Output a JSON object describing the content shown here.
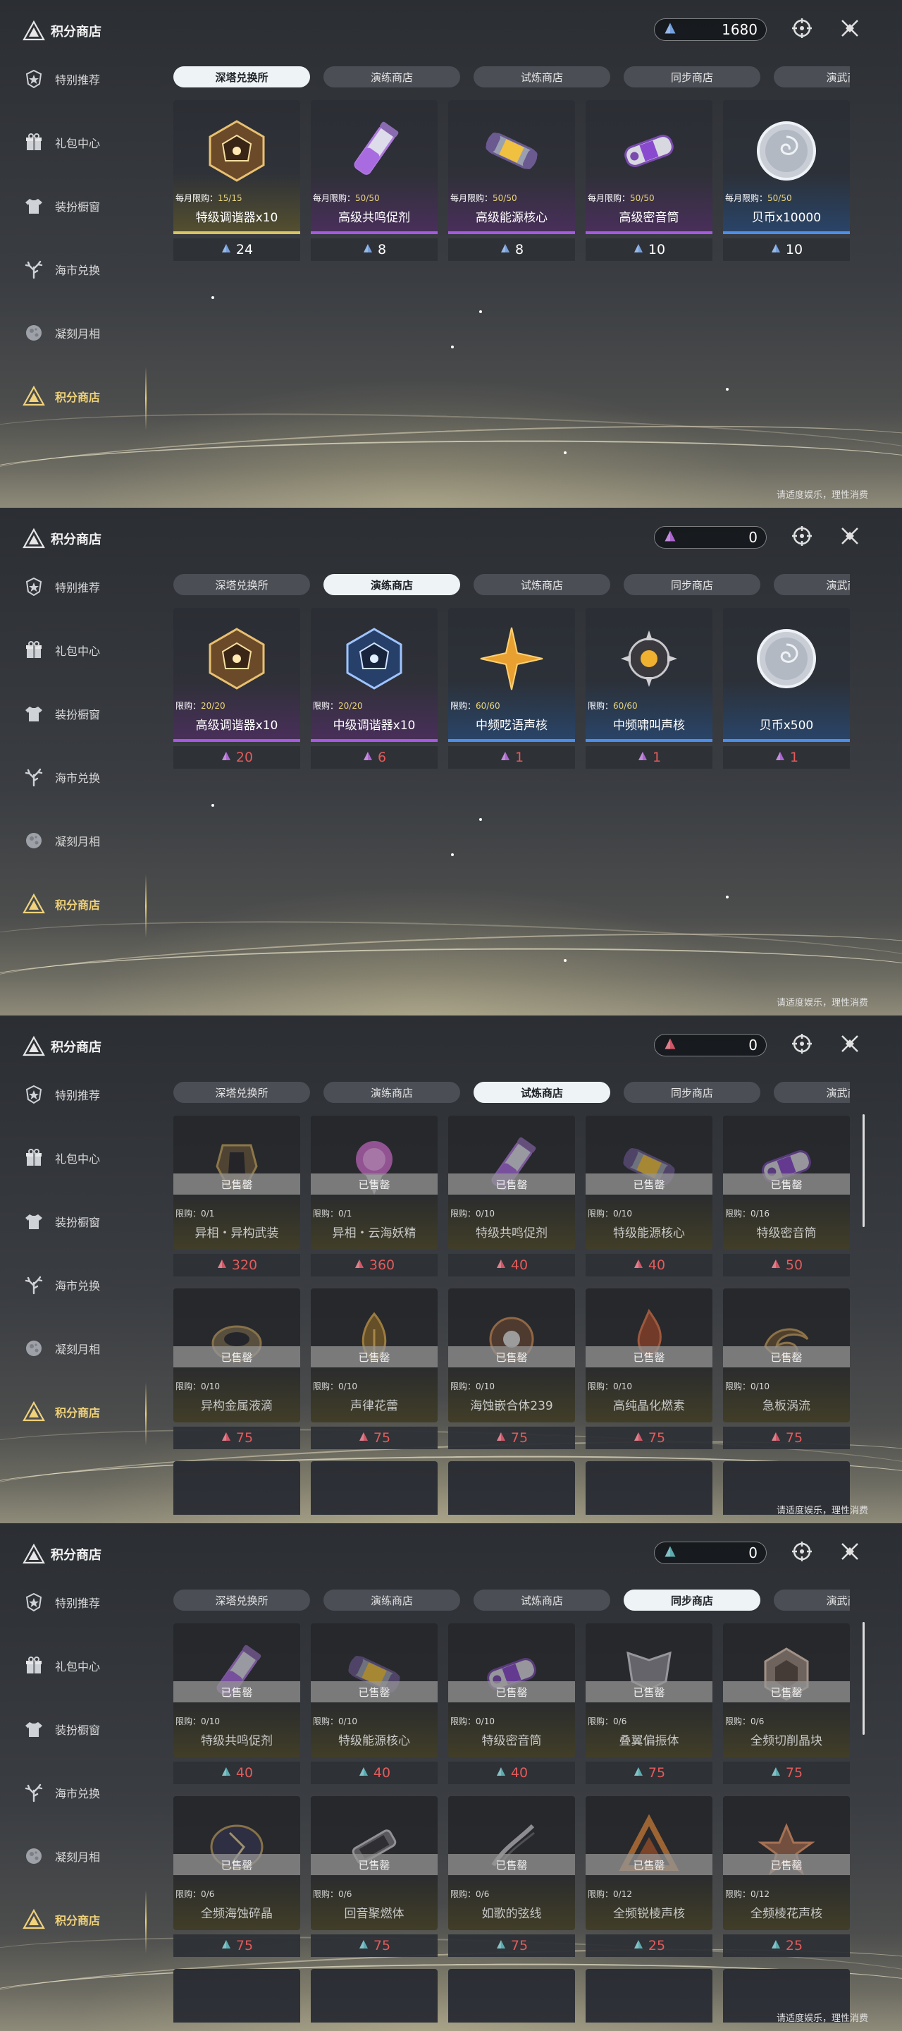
{
  "app": {
    "title": "积分商店",
    "nav": [
      {
        "label": "特别推荐",
        "icon": "star-shield-icon"
      },
      {
        "label": "礼包中心",
        "icon": "gift-icon"
      },
      {
        "label": "装扮橱窗",
        "icon": "outfit-icon"
      },
      {
        "label": "海市兑换",
        "icon": "coral-icon"
      },
      {
        "label": "凝刻月相",
        "icon": "moon-icon"
      },
      {
        "label": "积分商店",
        "icon": "triangle-emblem-icon"
      }
    ],
    "tip": "请适度娱乐，理性消费",
    "sold_label": "已售罄",
    "limit_prefix_monthly": "每月限购：",
    "limit_prefix": "限购：",
    "tabs": [
      "深塔兑换所",
      "演练商店",
      "试炼商店",
      "同步商店",
      "演武商"
    ],
    "colors": {
      "accent_gold": "#f0d27a",
      "price_red": "#e25b5b",
      "tab_active": "#eef3f6"
    }
  },
  "panels": [
    {
      "balance": "1680",
      "currency_color": "#7aa8e8",
      "active_tab": 0,
      "items": [
        {
          "name": "特级调谐器x10",
          "limit": "15/15",
          "monthly": true,
          "price": "24",
          "rarity": "gold",
          "icon": "dodecahedron-icon"
        },
        {
          "name": "高级共鸣促剂",
          "limit": "50/50",
          "monthly": true,
          "price": "8",
          "rarity": "purple",
          "icon": "vial-icon"
        },
        {
          "name": "高级能源核心",
          "limit": "50/50",
          "monthly": true,
          "price": "8",
          "rarity": "purple",
          "icon": "energy-core-icon"
        },
        {
          "name": "高级密音筒",
          "limit": "50/50",
          "monthly": true,
          "price": "10",
          "rarity": "purple",
          "icon": "sound-tube-icon"
        },
        {
          "name": "贝币x10000",
          "limit": "50/50",
          "monthly": true,
          "price": "10",
          "rarity": "blue",
          "icon": "coin-icon"
        }
      ]
    },
    {
      "balance": "0",
      "currency_color": "#b36ad8",
      "active_tab": 1,
      "items": [
        {
          "name": "高级调谐器x10",
          "limit": "20/20",
          "monthly": false,
          "price": "20",
          "rarity": "purple",
          "icon": "dodecahedron-icon"
        },
        {
          "name": "中级调谐器x10",
          "limit": "20/20",
          "monthly": false,
          "price": "6",
          "rarity": "purple",
          "icon": "dodecahedron-blue-icon"
        },
        {
          "name": "中频呓语声核",
          "limit": "60/60",
          "monthly": false,
          "price": "1",
          "rarity": "blue",
          "icon": "star-core-icon"
        },
        {
          "name": "中频啸叫声核",
          "limit": "60/60",
          "monthly": false,
          "price": "1",
          "rarity": "blue",
          "icon": "spiked-core-icon"
        },
        {
          "name": "贝币x500",
          "limit": "",
          "monthly": false,
          "price": "1",
          "rarity": "blue",
          "icon": "coin-icon"
        }
      ]
    },
    {
      "balance": "0",
      "currency_color": "#d85a6a",
      "active_tab": 2,
      "items": [
        {
          "name": "异相・异构武装",
          "limit": "0/1",
          "price": "320",
          "sold": true,
          "icon": "armor-icon"
        },
        {
          "name": "异相・云海妖精",
          "limit": "0/1",
          "price": "360",
          "sold": true,
          "icon": "fairy-icon"
        },
        {
          "name": "特级共鸣促剂",
          "limit": "0/10",
          "price": "40",
          "sold": true,
          "icon": "vial-icon"
        },
        {
          "name": "特级能源核心",
          "limit": "0/10",
          "price": "40",
          "sold": true,
          "icon": "energy-core-icon"
        },
        {
          "name": "特级密音筒",
          "limit": "0/16",
          "price": "50",
          "sold": true,
          "icon": "sound-tube-icon"
        },
        {
          "name": "异构金属液滴",
          "limit": "0/10",
          "price": "75",
          "sold": true,
          "icon": "metal-drop-icon"
        },
        {
          "name": "声律花蕾",
          "limit": "0/10",
          "price": "75",
          "sold": true,
          "icon": "flower-bud-icon"
        },
        {
          "name": "海蚀嵌合体239",
          "limit": "0/10",
          "price": "75",
          "sold": true,
          "icon": "chimera-icon"
        },
        {
          "name": "高纯晶化燃素",
          "limit": "0/10",
          "price": "75",
          "sold": true,
          "icon": "flame-crystal-icon"
        },
        {
          "name": "急板涡流",
          "limit": "0/10",
          "price": "75",
          "sold": true,
          "icon": "vortex-icon"
        }
      ]
    },
    {
      "balance": "0",
      "currency_color": "#5fb3b8",
      "active_tab": 3,
      "items": [
        {
          "name": "特级共鸣促剂",
          "limit": "0/10",
          "price": "40",
          "sold": true,
          "icon": "vial-icon"
        },
        {
          "name": "特级能源核心",
          "limit": "0/10",
          "price": "40",
          "sold": true,
          "icon": "energy-core-icon"
        },
        {
          "name": "特级密音筒",
          "limit": "0/10",
          "price": "40",
          "sold": true,
          "icon": "sound-tube-icon"
        },
        {
          "name": "叠翼偏振体",
          "limit": "0/6",
          "price": "75",
          "sold": true,
          "icon": "wing-icon"
        },
        {
          "name": "全频切削晶块",
          "limit": "0/6",
          "price": "75",
          "sold": true,
          "icon": "crystal-block-icon"
        },
        {
          "name": "全频海蚀碎晶",
          "limit": "0/6",
          "price": "75",
          "sold": true,
          "icon": "shard-icon"
        },
        {
          "name": "回音聚燃体",
          "limit": "0/6",
          "price": "75",
          "sold": true,
          "icon": "burner-icon"
        },
        {
          "name": "如歌的弦线",
          "limit": "0/6",
          "price": "75",
          "sold": true,
          "icon": "string-icon"
        },
        {
          "name": "全频锐棱声核",
          "limit": "0/12",
          "price": "25",
          "sold": true,
          "icon": "prism-core-icon"
        },
        {
          "name": "全频棱花声核",
          "limit": "0/12",
          "price": "25",
          "sold": true,
          "icon": "prism-flower-icon"
        }
      ]
    }
  ]
}
